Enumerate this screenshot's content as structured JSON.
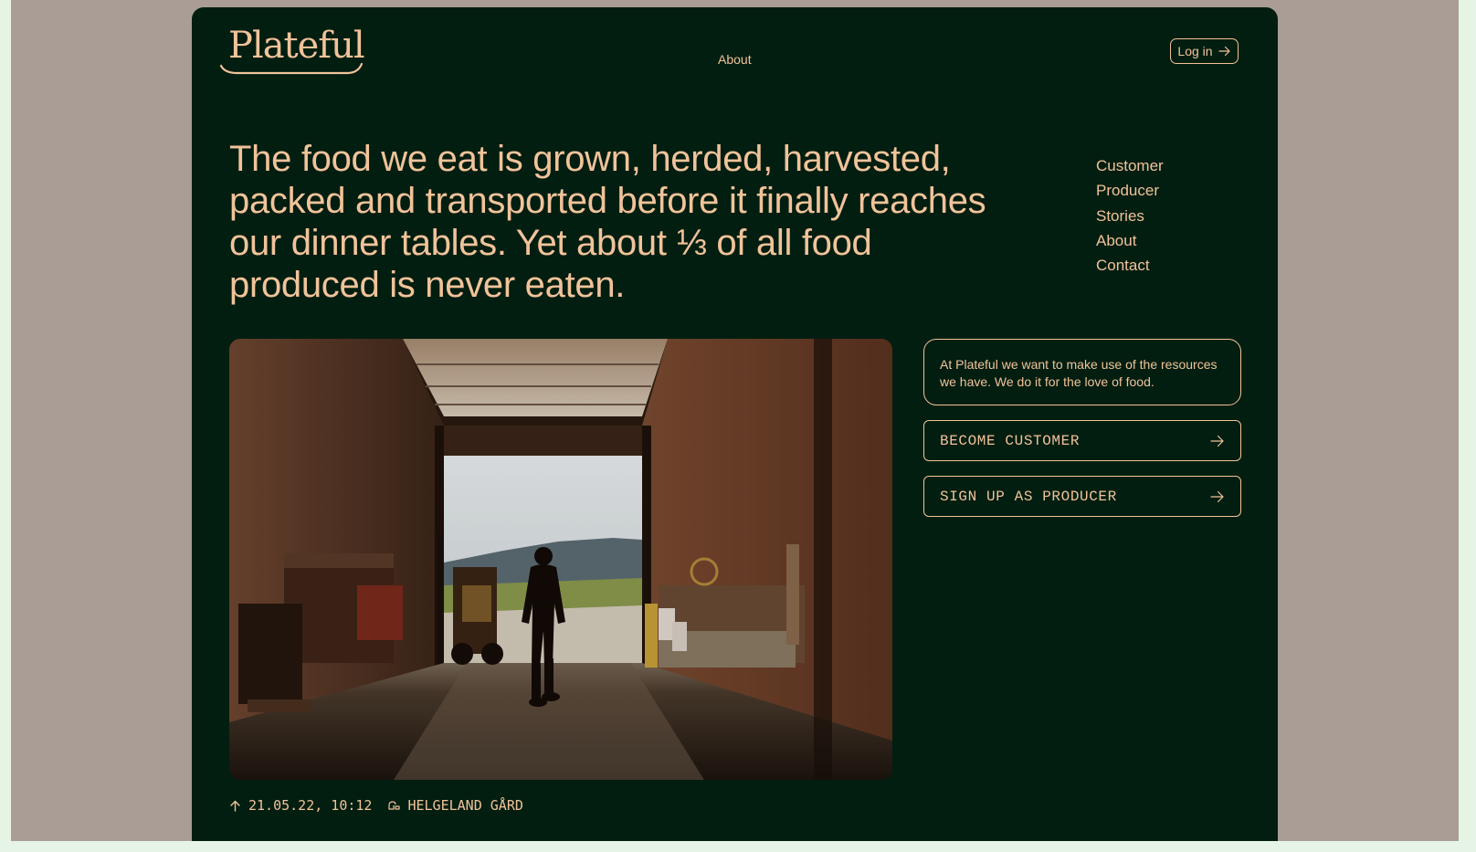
{
  "header": {
    "logo": "Plateful",
    "nav_link": "About",
    "login_label": "Log in"
  },
  "hero": {
    "headline": "The food we eat is grown, herded, harvested, packed and transported before it finally reaches our dinner tables. Yet about ⅓ of all food produced is never eaten."
  },
  "side_nav": {
    "items": [
      "Customer",
      "Producer",
      "Stories",
      "About",
      "Contact"
    ]
  },
  "info": {
    "text": "At Plateful we want to make use of the resources we have. We do it for the love of food."
  },
  "cta": {
    "become_customer": "BECOME CUSTOMER",
    "sign_up_producer": "SIGN UP AS PRODUCER"
  },
  "caption": {
    "timestamp": "21.05.22, 10:12",
    "location": "HELGELAND GÅRD"
  },
  "colors": {
    "card_background": "#021e10",
    "accent": "#f1c39a",
    "page_background": "#a99d95"
  },
  "icons": {
    "login": "arrow-right-icon",
    "cta": "arrow-right-icon",
    "timestamp": "arrow-up-icon",
    "location": "farm-icon"
  }
}
